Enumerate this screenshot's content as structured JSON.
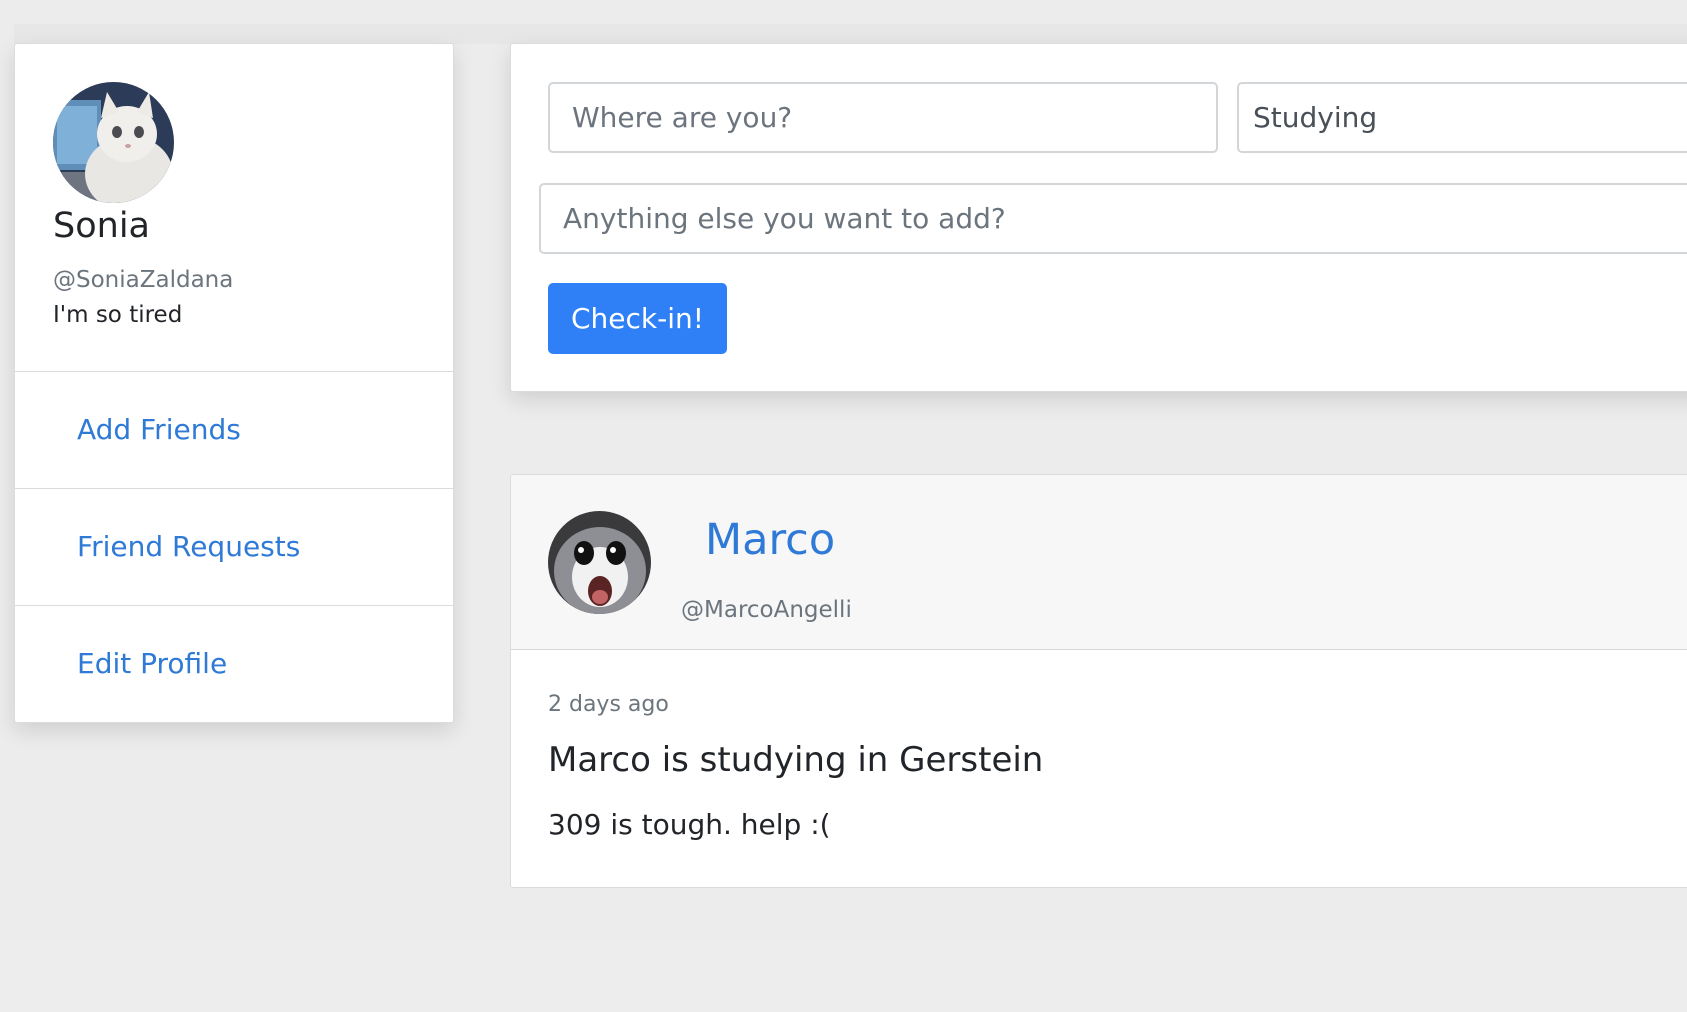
{
  "profile": {
    "name": "Sonia",
    "handle": "@SoniaZaldana",
    "status": "I'm so tired",
    "nav": [
      {
        "label": "Add Friends"
      },
      {
        "label": "Friend Requests"
      },
      {
        "label": "Edit Profile"
      }
    ]
  },
  "checkin": {
    "location_placeholder": "Where are you?",
    "activity_value": "Studying",
    "extra_placeholder": "Anything else you want to add?",
    "button_label": "Check-in!"
  },
  "post": {
    "author": "Marco",
    "handle": "@MarcoAngelli",
    "time": "2 days ago",
    "title": "Marco is studying in Gerstein",
    "text": "309 is tough. help :("
  },
  "colors": {
    "link": "#2f7ad6",
    "primary_button": "#2f80f7",
    "page_background": "#ececec"
  }
}
